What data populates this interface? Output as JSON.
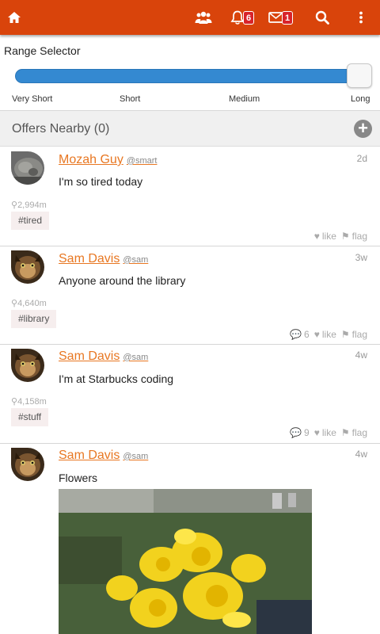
{
  "topbar": {
    "notifications_count": "6",
    "messages_count": "1",
    "icons": [
      "home-icon",
      "group-icon",
      "bell-icon",
      "envelope-icon",
      "search-icon",
      "more-vertical-icon"
    ],
    "accent": "#d9440b"
  },
  "range": {
    "title": "Range Selector",
    "ticks": [
      "Very Short",
      "Short",
      "Medium",
      "Long"
    ],
    "value_fraction": 1.0
  },
  "offers": {
    "title": "Offers Nearby (0)"
  },
  "posts": [
    {
      "name": "Mozah Guy",
      "handle": "@smart",
      "time": "2d",
      "message": "I'm so tired today",
      "distance": "2,994m",
      "tag": "#tired",
      "comments": "",
      "like": "like",
      "flag": "flag"
    },
    {
      "name": "Sam Davis",
      "handle": "@sam",
      "time": "3w",
      "message": "Anyone around the library",
      "distance": "4,640m",
      "tag": "#library",
      "comments": "6",
      "like": "like",
      "flag": "flag"
    },
    {
      "name": "Sam Davis",
      "handle": "@sam",
      "time": "4w",
      "message": "I'm at Starbucks coding",
      "distance": "4,158m",
      "tag": "#stuff",
      "comments": "9",
      "like": "like",
      "flag": "flag"
    },
    {
      "name": "Sam Davis",
      "handle": "@sam",
      "time": "4w",
      "message": "Flowers",
      "distance": "",
      "tag": "",
      "comments": "",
      "like": "",
      "flag": ""
    }
  ]
}
